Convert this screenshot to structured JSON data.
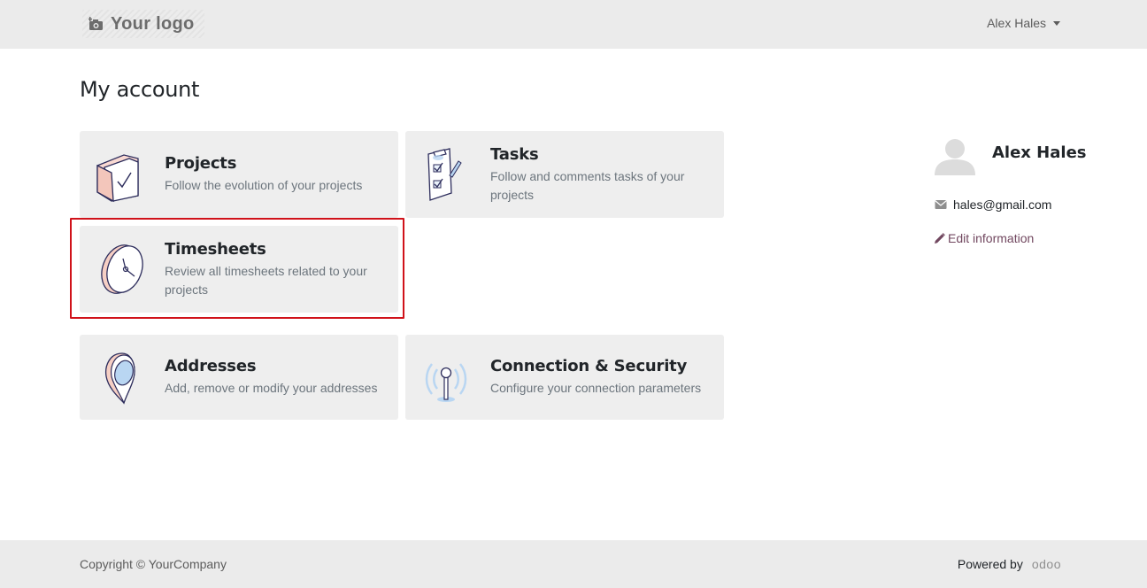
{
  "navbar": {
    "logo_text": "Your logo",
    "user_name": "Alex Hales"
  },
  "page": {
    "title": "My account"
  },
  "cards": [
    {
      "title": "Projects",
      "description": "Follow the evolution of your projects"
    },
    {
      "title": "Tasks",
      "description": "Follow and comments tasks of your projects"
    },
    {
      "title": "Timesheets",
      "description": "Review all timesheets related to your projects"
    },
    {
      "title": "Addresses",
      "description": "Add, remove or modify your addresses"
    },
    {
      "title": "Connection & Security",
      "description": "Configure your connection parameters"
    }
  ],
  "sidebar": {
    "name": "Alex Hales",
    "email": "hales@gmail.com",
    "edit_label": "Edit information"
  },
  "footer": {
    "copyright": "Copyright © YourCompany",
    "powered_by": "Powered by",
    "brand": "odoo"
  },
  "colors": {
    "link": "#71475f",
    "highlight": "#d0121a",
    "card_bg": "#eeeeee",
    "navbar_bg": "#ebebeb"
  }
}
